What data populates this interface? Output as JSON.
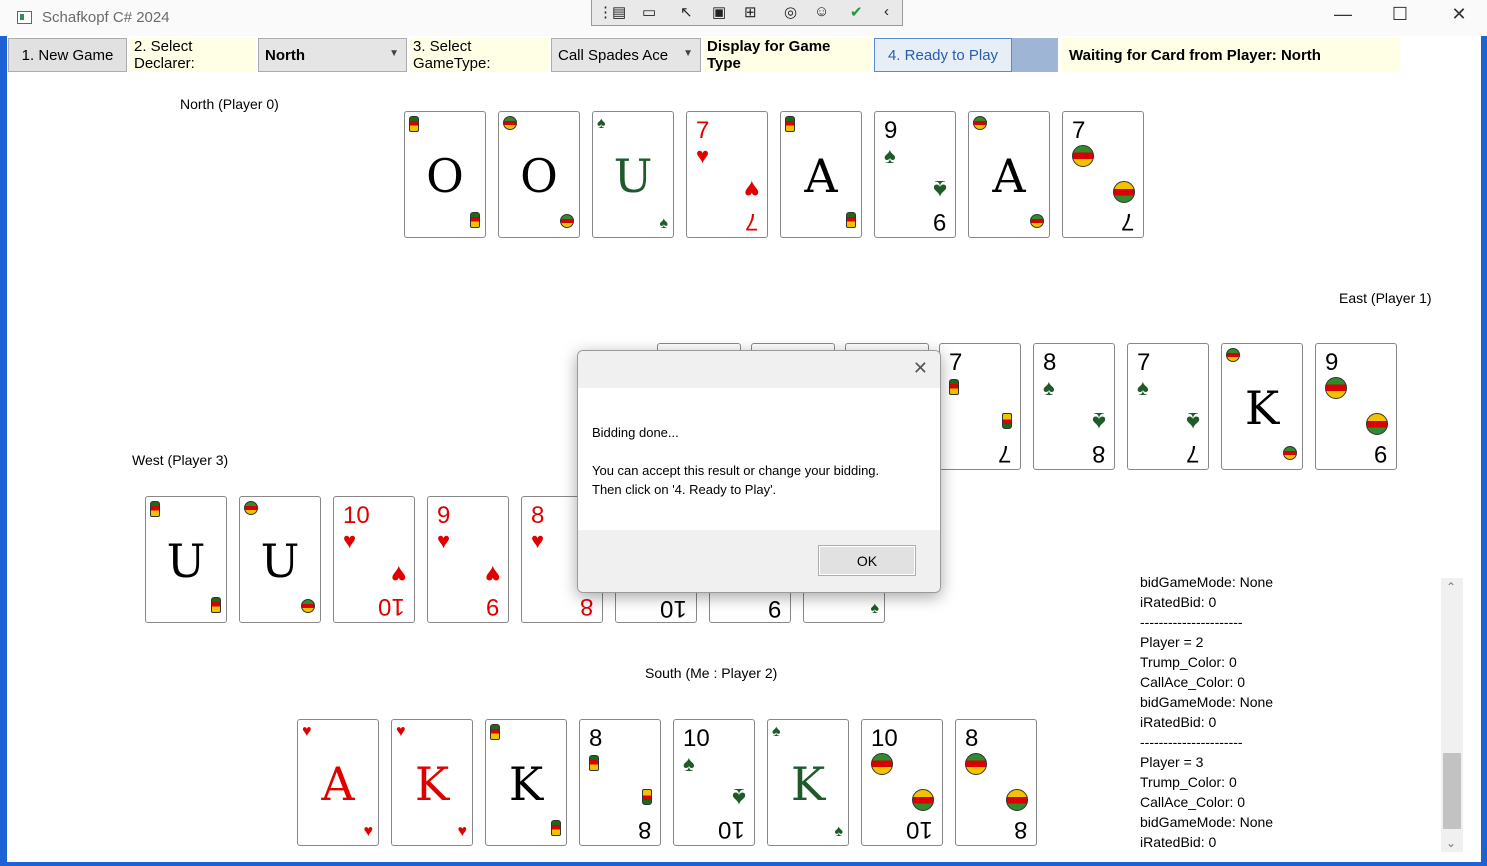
{
  "window": {
    "title": "Schafkopf C# 2024"
  },
  "devtools": {
    "icons": [
      "select-element-icon",
      "video-icon",
      "pointer-icon",
      "frame-icon",
      "layout-icon",
      "hot-reload-icon",
      "accessibility-icon",
      "check-icon",
      "collapse-icon"
    ]
  },
  "toolbar": {
    "new_game": "1. New Game",
    "select_declarer": "2. Select Declarer:",
    "declarer_value": "North",
    "select_gametype": "3. Select GameType:",
    "gametype_value": "Call Spades Ace",
    "display_label": "Display for Game Type",
    "ready": "4. Ready to Play",
    "waiting": "Waiting for Card from Player:  North"
  },
  "players": {
    "north": "North (Player 0)",
    "east": "East (Player 1)",
    "west": "West (Player 3)",
    "south": "South (Me : Player 2)"
  },
  "cards": {
    "north": [
      {
        "rank": "O",
        "suit": "acorns"
      },
      {
        "rank": "O",
        "suit": "bells"
      },
      {
        "rank": "U",
        "suit": "leaves"
      },
      {
        "rank": "7",
        "suit": "hearts",
        "flip": "7"
      },
      {
        "rank": "A",
        "suit": "acorns"
      },
      {
        "rank": "9",
        "suit": "leaves",
        "flip": "9"
      },
      {
        "rank": "A",
        "suit": "bells"
      },
      {
        "rank": "7",
        "suit": "bells",
        "flip": "7"
      }
    ],
    "east": [
      {
        "rank": "7",
        "suit": "acorns",
        "flip": "7"
      },
      {
        "rank": "8",
        "suit": "leaves",
        "flip": "8"
      },
      {
        "rank": "7",
        "suit": "leaves",
        "flip": "7"
      },
      {
        "rank": "K",
        "suit": "bells"
      },
      {
        "rank": "9",
        "suit": "bells",
        "flip": "9"
      }
    ],
    "west": [
      {
        "rank": "U",
        "suit": "acorns"
      },
      {
        "rank": "U",
        "suit": "bells"
      },
      {
        "rank": "10",
        "suit": "hearts",
        "flip": "10"
      },
      {
        "rank": "9",
        "suit": "hearts",
        "flip": "9"
      },
      {
        "rank": "8",
        "suit": "hearts",
        "flip": "8"
      }
    ],
    "west_partial": [
      "10",
      "9"
    ],
    "south": [
      {
        "rank": "A",
        "suit": "hearts"
      },
      {
        "rank": "K",
        "suit": "hearts"
      },
      {
        "rank": "K",
        "suit": "acorns"
      },
      {
        "rank": "8",
        "suit": "acorns",
        "flip": "8"
      },
      {
        "rank": "10",
        "suit": "leaves",
        "flip": "10"
      },
      {
        "rank": "K",
        "suit": "leaves"
      },
      {
        "rank": "10",
        "suit": "bells",
        "flip": "10"
      },
      {
        "rank": "8",
        "suit": "bells",
        "flip": "8"
      }
    ]
  },
  "dialog": {
    "line1": "Bidding done...",
    "line2": "You can accept this result or change your bidding.",
    "line3": "Then click on '4. Ready to Play'.",
    "ok": "OK"
  },
  "log": {
    "lines": [
      "bidGameMode: None",
      "iRatedBid: 0",
      "----------------------",
      "Player = 2",
      "Trump_Color: 0",
      "CallAce_Color: 0",
      "bidGameMode: None",
      "iRatedBid: 0",
      "----------------------",
      "Player = 3",
      "Trump_Color: 0",
      "CallAce_Color: 0",
      "bidGameMode: None",
      "iRatedBid: 0"
    ]
  },
  "colors": {
    "window_border": "#1e63d6",
    "highlight": "#ffffe6",
    "ready_square": "#9fb5d6"
  }
}
